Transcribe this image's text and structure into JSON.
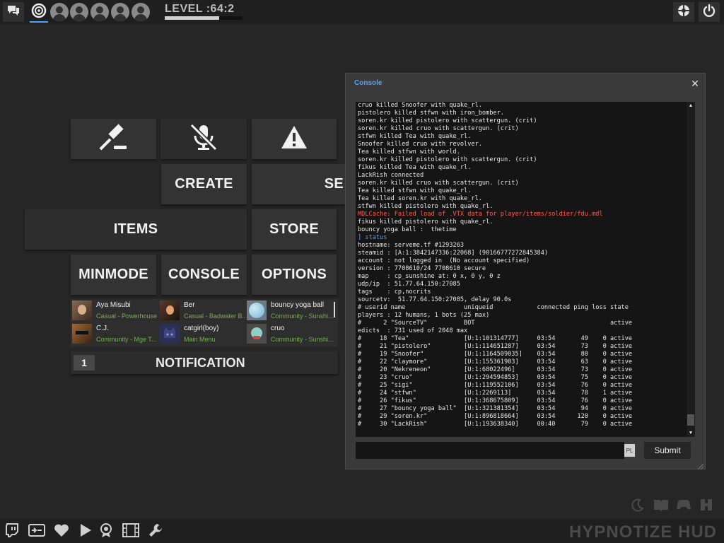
{
  "topbar": {
    "level_label": "LEVEL :64:2",
    "level_progress": 0.7,
    "avatar_slots": 5
  },
  "menu": {
    "create": "CREATE",
    "servers": "SE",
    "items": "ITEMS",
    "store": "STORE",
    "minmode": "MINMODE",
    "console": "CONSOLE",
    "options": "OPTIONS"
  },
  "friends": [
    {
      "name": "Aya Misubi",
      "status": "Casual - Powerhouse"
    },
    {
      "name": "Ber",
      "status": "Casual - Badwater B..."
    },
    {
      "name": "bouncy yoga ball",
      "status": "Community - Sunshi..."
    },
    {
      "name": "C.J.",
      "status": "Community - Mge T..."
    },
    {
      "name": "catgirl(boy)",
      "status": "Main Menu"
    },
    {
      "name": "cruo",
      "status": "Community - Sunshi..."
    }
  ],
  "notification": {
    "count": "1",
    "label": "NOTIFICATION"
  },
  "console": {
    "title": "Console",
    "input_value": "",
    "pl_tag": "PL",
    "submit_label": "Submit",
    "lines": [
      {
        "text": "cruo killed Snoofer with quake_rl.",
        "type": "normal"
      },
      {
        "text": "pistolero killed stfwn with iron_bomber.",
        "type": "normal"
      },
      {
        "text": "soren.kr killed pistolero with scattergun. (crit)",
        "type": "normal"
      },
      {
        "text": "soren.kr killed cruo with scattergun. (crit)",
        "type": "normal"
      },
      {
        "text": "stfwn killed Tea with quake_rl.",
        "type": "normal"
      },
      {
        "text": "Snoofer killed cruo with revolver.",
        "type": "normal"
      },
      {
        "text": "Tea killed stfwn with world.",
        "type": "normal"
      },
      {
        "text": "soren.kr killed pistolero with scattergun. (crit)",
        "type": "normal"
      },
      {
        "text": "fikus killed Tea with quake_rl.",
        "type": "normal"
      },
      {
        "text": "LackRish connected",
        "type": "normal"
      },
      {
        "text": "soren.kr killed cruo with scattergun. (crit)",
        "type": "normal"
      },
      {
        "text": "Tea killed stfwn with quake_rl.",
        "type": "normal"
      },
      {
        "text": "Tea killed soren.kr with quake_rl.",
        "type": "normal"
      },
      {
        "text": "stfwn killed pistolero with quake_rl.",
        "type": "normal"
      },
      {
        "text": "MDLCache: Failed load of .VTX data for player/items/soldier/fdu.mdl",
        "type": "error"
      },
      {
        "text": "fikus killed pistolero with quake_rl.",
        "type": "normal"
      },
      {
        "text": "bouncy yoga ball :  thetime",
        "type": "normal"
      },
      {
        "text": "] status",
        "type": "command"
      },
      {
        "text": "hostname: serveme.tf #1293263",
        "type": "normal"
      },
      {
        "text": "steamid : [A:1:3842147336:22068] (90166777272845384)",
        "type": "normal"
      },
      {
        "text": "account : not logged in  (No account specified)",
        "type": "normal"
      },
      {
        "text": "version : 7708610/24 7708610 secure",
        "type": "normal"
      },
      {
        "text": "map     : cp_sunshine at: 0 x, 0 y, 0 z",
        "type": "normal"
      },
      {
        "text": "udp/ip  : 51.77.64.150:27085",
        "type": "normal"
      },
      {
        "text": "tags    : cp,nocrits",
        "type": "normal"
      },
      {
        "text": "sourcetv:  51.77.64.150:27085, delay 90.0s",
        "type": "normal"
      },
      {
        "text": "# userid name                uniqueid            connected ping loss state",
        "type": "normal"
      },
      {
        "text": "players : 12 humans, 1 bots (25 max)",
        "type": "normal"
      },
      {
        "text": "#      2 \"SourceTV\"          BOT                                     active",
        "type": "normal"
      },
      {
        "text": "edicts  : 731 used of 2048 max",
        "type": "normal"
      },
      {
        "text": "#     18 \"Tea\"               [U:1:101314777]     03:54       49    0 active",
        "type": "normal"
      },
      {
        "text": "#     21 \"pistolero\"         [U:1:114651287]     03:54       73    0 active",
        "type": "normal"
      },
      {
        "text": "#     19 \"Snoofer\"           [U:1:1164509035]    03:54       80    0 active",
        "type": "normal"
      },
      {
        "text": "#     22 \"claymore\"          [U:1:155361903]     03:54       63    0 active",
        "type": "normal"
      },
      {
        "text": "#     20 \"Nekreneon\"         [U:1:68022496]      03:54       73    0 active",
        "type": "normal"
      },
      {
        "text": "#     23 \"cruo\"              [U:1:294594853]     03:54       75    0 active",
        "type": "normal"
      },
      {
        "text": "#     25 \"sigi\"              [U:1:119552106]     03:54       76    0 active",
        "type": "normal"
      },
      {
        "text": "#     24 \"stfwn\"             [U:1:2269113]       03:54       78    1 active",
        "type": "normal"
      },
      {
        "text": "#     26 \"fikus\"             [U:1:368675809]     03:54       76    0 active",
        "type": "normal"
      },
      {
        "text": "#     27 \"bouncy yoga ball\"  [U:1:321381354]     03:54       94    0 active",
        "type": "normal"
      },
      {
        "text": "#     29 \"soren.kr\"          [U:1:896818664]     03:54      120    0 active",
        "type": "normal"
      },
      {
        "text": "#     30 \"LackRish\"          [U:1:193638340]     00:40       79    0 active",
        "type": "normal"
      }
    ]
  },
  "colors": {
    "log_text": "#e8e8e8",
    "log_error": "#ff5a4f",
    "log_command": "#4ea3ff",
    "friend_status": "#74b04e",
    "title_accent": "#4ea3ff"
  },
  "icons": {
    "top_left": [
      "chat-icon",
      "logo-icon"
    ],
    "top_right": [
      "settings-icon",
      "power-icon"
    ],
    "menu": [
      "gavel-icon",
      "mute-icon",
      "warning-icon"
    ],
    "bottom": [
      "twitch-icon",
      "demo-icon",
      "heart-icon",
      "play-icon",
      "achievements-icon",
      "replay-icon",
      "wrench-icon"
    ],
    "bottom_right": [
      "moon-icon",
      "book-icon",
      "controller-icon",
      "hud-icon"
    ]
  },
  "brand": "HYPNOTIZE HUD"
}
